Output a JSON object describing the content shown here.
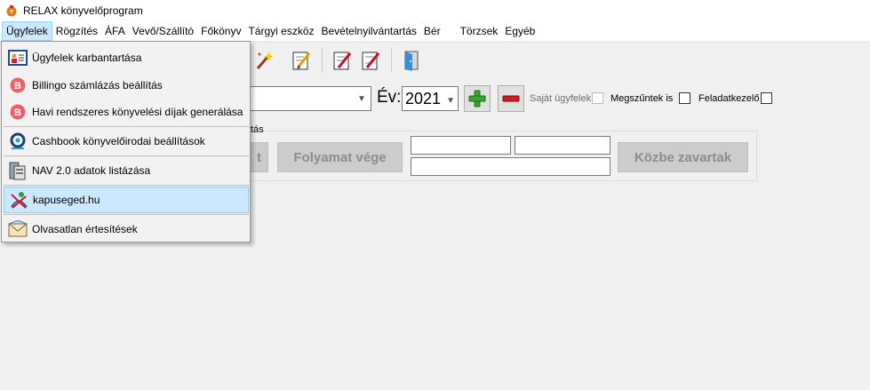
{
  "window": {
    "title": "RELAX könyvelőprogram"
  },
  "menu": [
    {
      "label": "Ügyfelek"
    },
    {
      "label": "Rögzítés"
    },
    {
      "label": "ÁFA"
    },
    {
      "label": "Vevő/Szállító"
    },
    {
      "label": "Főkönyv"
    },
    {
      "label": "Tárgyi eszköz"
    },
    {
      "label": "Bevételnyilvántartás"
    },
    {
      "label": "Bér"
    },
    {
      "label": "Törzsek"
    },
    {
      "label": "Egyéb"
    }
  ],
  "dropdown": {
    "items": [
      {
        "label": "Ügyfelek karbantartása",
        "icon": "client-card-icon"
      },
      {
        "label": "Billingo számlázás beállítás",
        "icon": "billingo-icon"
      },
      {
        "label": "Havi rendszeres könyvelési díjak generálása",
        "icon": "billingo-icon"
      },
      {
        "label": "Cashbook könyvelőirodai beállítások",
        "icon": "cashbook-icon"
      },
      {
        "label": "NAV 2.0 adatok listázása",
        "icon": "nav-document-icon"
      },
      {
        "label": "kapuseged.hu",
        "icon": "kapuseged-icon"
      },
      {
        "label": "Olvasatlan értesítések",
        "icon": "envelope-icon"
      }
    ]
  },
  "filter": {
    "year_label": "Év:",
    "year_value": "2021",
    "own_clients_label": "Saját ügyfelek",
    "discontinued_label": "Megszűntek is",
    "task_manager_label": "Feladatkezelő"
  },
  "group": {
    "legend": "tás",
    "start_button": "t",
    "process_end_button": "Folyamat vége",
    "closed_button": "Közbe zavartak"
  },
  "colors": {
    "menu_highlight": "#cce8ff",
    "add_green": "#3aa52f",
    "remove_red": "#d11c1c"
  }
}
